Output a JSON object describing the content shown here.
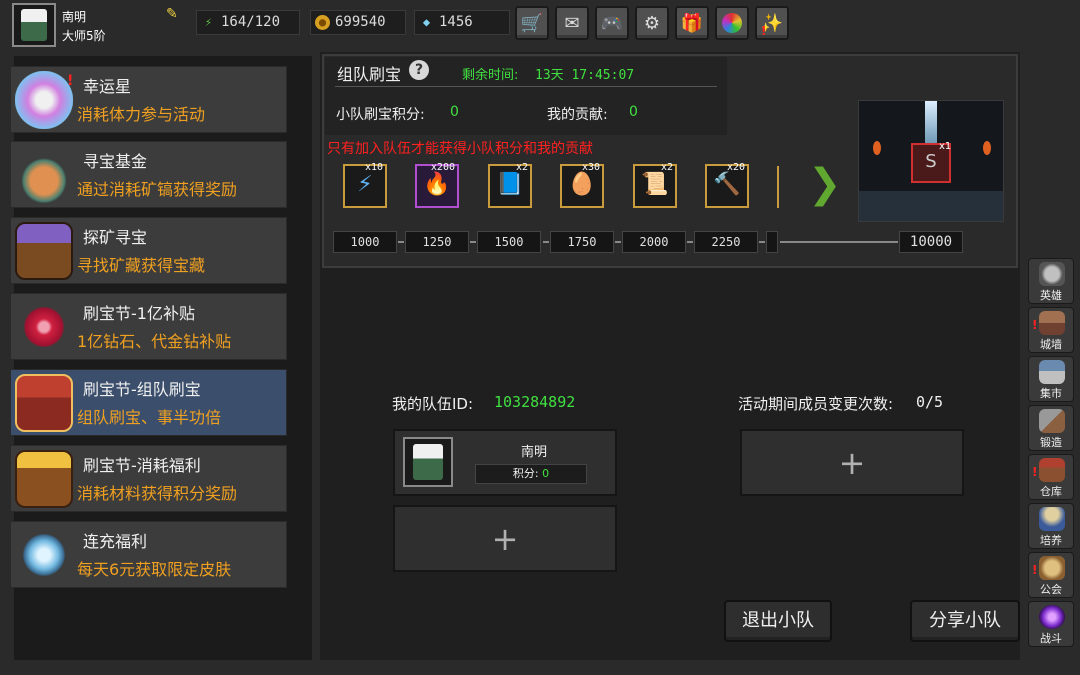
{
  "player": {
    "name": "南明",
    "rank": "大师5阶"
  },
  "resources": {
    "stamina": "164/120",
    "gold": "699540",
    "gems": "1456"
  },
  "toolbar_icons": [
    "shop-icon",
    "mail-icon",
    "gamepad-icon",
    "gear-icon",
    "gift-icon",
    "color-wheel-icon",
    "fireworks-icon"
  ],
  "menu": [
    {
      "title": "幸运星",
      "desc": "消耗体力参与活动",
      "alert": "!"
    },
    {
      "title": "寻宝基金",
      "desc": "通过消耗矿镐获得奖励",
      "alert": ""
    },
    {
      "title": "探矿寻宝",
      "desc": "寻找矿藏获得宝藏",
      "alert": ""
    },
    {
      "title": "刷宝节-1亿补贴",
      "desc": "1亿钻石、代金钻补贴",
      "alert": ""
    },
    {
      "title": "刷宝节-组队刷宝",
      "desc": "组队刷宝、事半功倍",
      "alert": ""
    },
    {
      "title": "刷宝节-消耗福利",
      "desc": "消耗材料获得积分奖励",
      "alert": ""
    },
    {
      "title": "连充福利",
      "desc": "每天6元获取限定皮肤",
      "alert": ""
    }
  ],
  "event": {
    "title": "组队刷宝",
    "help": "?",
    "timer_label": "剩余时间:",
    "timer_value": "13天 17:45:07",
    "team_score_label": "小队刷宝积分:",
    "team_score_value": "0",
    "contribution_label": "我的贡献:",
    "contribution_value": "0",
    "warning": "只有加入队伍才能获得小队积分和我的贡献"
  },
  "rewards": [
    {
      "qty": "x10",
      "icon": "lightning-scroll-icon",
      "glyph": "⚡"
    },
    {
      "qty": "x200",
      "icon": "fire-sword-icon",
      "glyph": "🔥"
    },
    {
      "qty": "x2",
      "icon": "spellbook-icon",
      "glyph": "📘"
    },
    {
      "qty": "x30",
      "icon": "egg-icon",
      "glyph": "🥚"
    },
    {
      "qty": "x2",
      "icon": "scroll-icon",
      "glyph": "📜"
    },
    {
      "qty": "x20",
      "icon": "mace-icon",
      "glyph": "🔨"
    }
  ],
  "milestones": [
    "1000",
    "1250",
    "1500",
    "1750",
    "2000",
    "2250",
    "",
    "10000"
  ],
  "grand_prize": {
    "qty": "x1",
    "icon": "character-skin-icon",
    "glyph": "S"
  },
  "team": {
    "id_label": "我的队伍ID:",
    "id_value": "103284892",
    "changes_label": "活动期间成员变更次数:",
    "changes_value": "0/5",
    "member_name": "南明",
    "member_score_label": "积分:",
    "member_score_value": "0",
    "plus": "+"
  },
  "buttons": {
    "leave": "退出小队",
    "share": "分享小队"
  },
  "right_nav": [
    {
      "label": "英雄",
      "icon": "helmet-icon",
      "alert": ""
    },
    {
      "label": "城墙",
      "icon": "wall-icon",
      "alert": "!"
    },
    {
      "label": "集市",
      "icon": "market-icon",
      "alert": ""
    },
    {
      "label": "锻造",
      "icon": "anvil-icon",
      "alert": ""
    },
    {
      "label": "仓库",
      "icon": "warehouse-icon",
      "alert": "!"
    },
    {
      "label": "培养",
      "icon": "trophy-icon",
      "alert": ""
    },
    {
      "label": "公会",
      "icon": "guild-icon",
      "alert": "!"
    },
    {
      "label": "战斗",
      "icon": "portal-icon",
      "alert": ""
    }
  ]
}
